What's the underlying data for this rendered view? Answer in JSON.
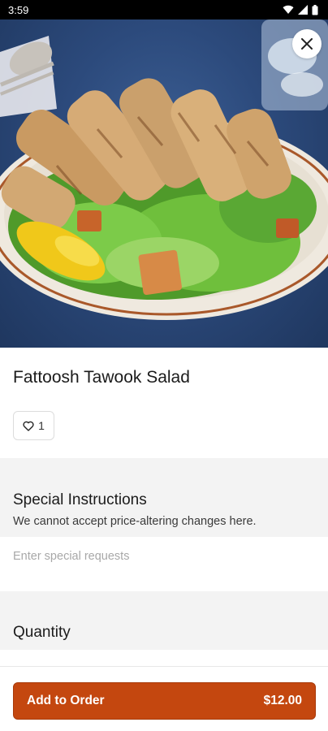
{
  "status_bar": {
    "time": "3:59"
  },
  "item": {
    "title": "Fattoosh Tawook Salad",
    "likes": "1"
  },
  "special_instructions": {
    "title": "Special Instructions",
    "subtitle": "We cannot accept price-altering changes here.",
    "placeholder": "Enter special requests",
    "value": ""
  },
  "quantity": {
    "title": "Quantity"
  },
  "cta": {
    "label": "Add to Order",
    "price": "$12.00"
  },
  "colors": {
    "accent": "#c4470f",
    "section_bg": "#f3f3f3",
    "hero_bg": "#2c4a7c"
  },
  "icons": {
    "close": "close-icon",
    "heart": "heart-icon",
    "wifi": "wifi-icon",
    "signal": "signal-icon",
    "battery": "battery-icon"
  }
}
